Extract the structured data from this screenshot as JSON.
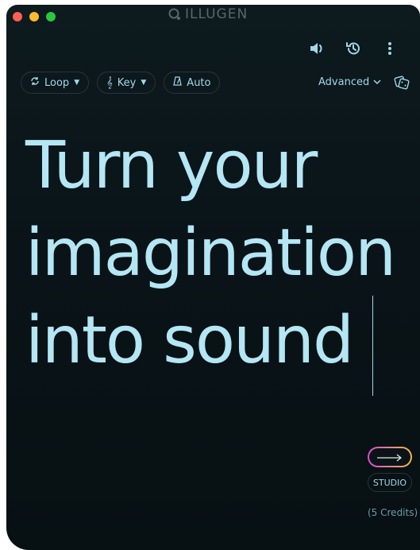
{
  "brand": {
    "name": "ILLUGEN",
    "icon": "search-like-logo-icon"
  },
  "top_icons": [
    "volume-icon",
    "history-icon",
    "more-vertical-icon"
  ],
  "toolbar": {
    "loop_label": "Loop",
    "key_label": "Key",
    "auto_label": "Auto",
    "advanced_label": "Advanced"
  },
  "prompt": {
    "line1": "Turn your",
    "line2": "imagination",
    "line3": "into sound"
  },
  "actions": {
    "studio_label": "STUDIO",
    "credits_text": "(5 Credits)"
  },
  "colors": {
    "accent": "#9fd8ea",
    "background": "#0a1418",
    "gradient_start": "#d94bd4",
    "gradient_end": "#f0b84a"
  }
}
